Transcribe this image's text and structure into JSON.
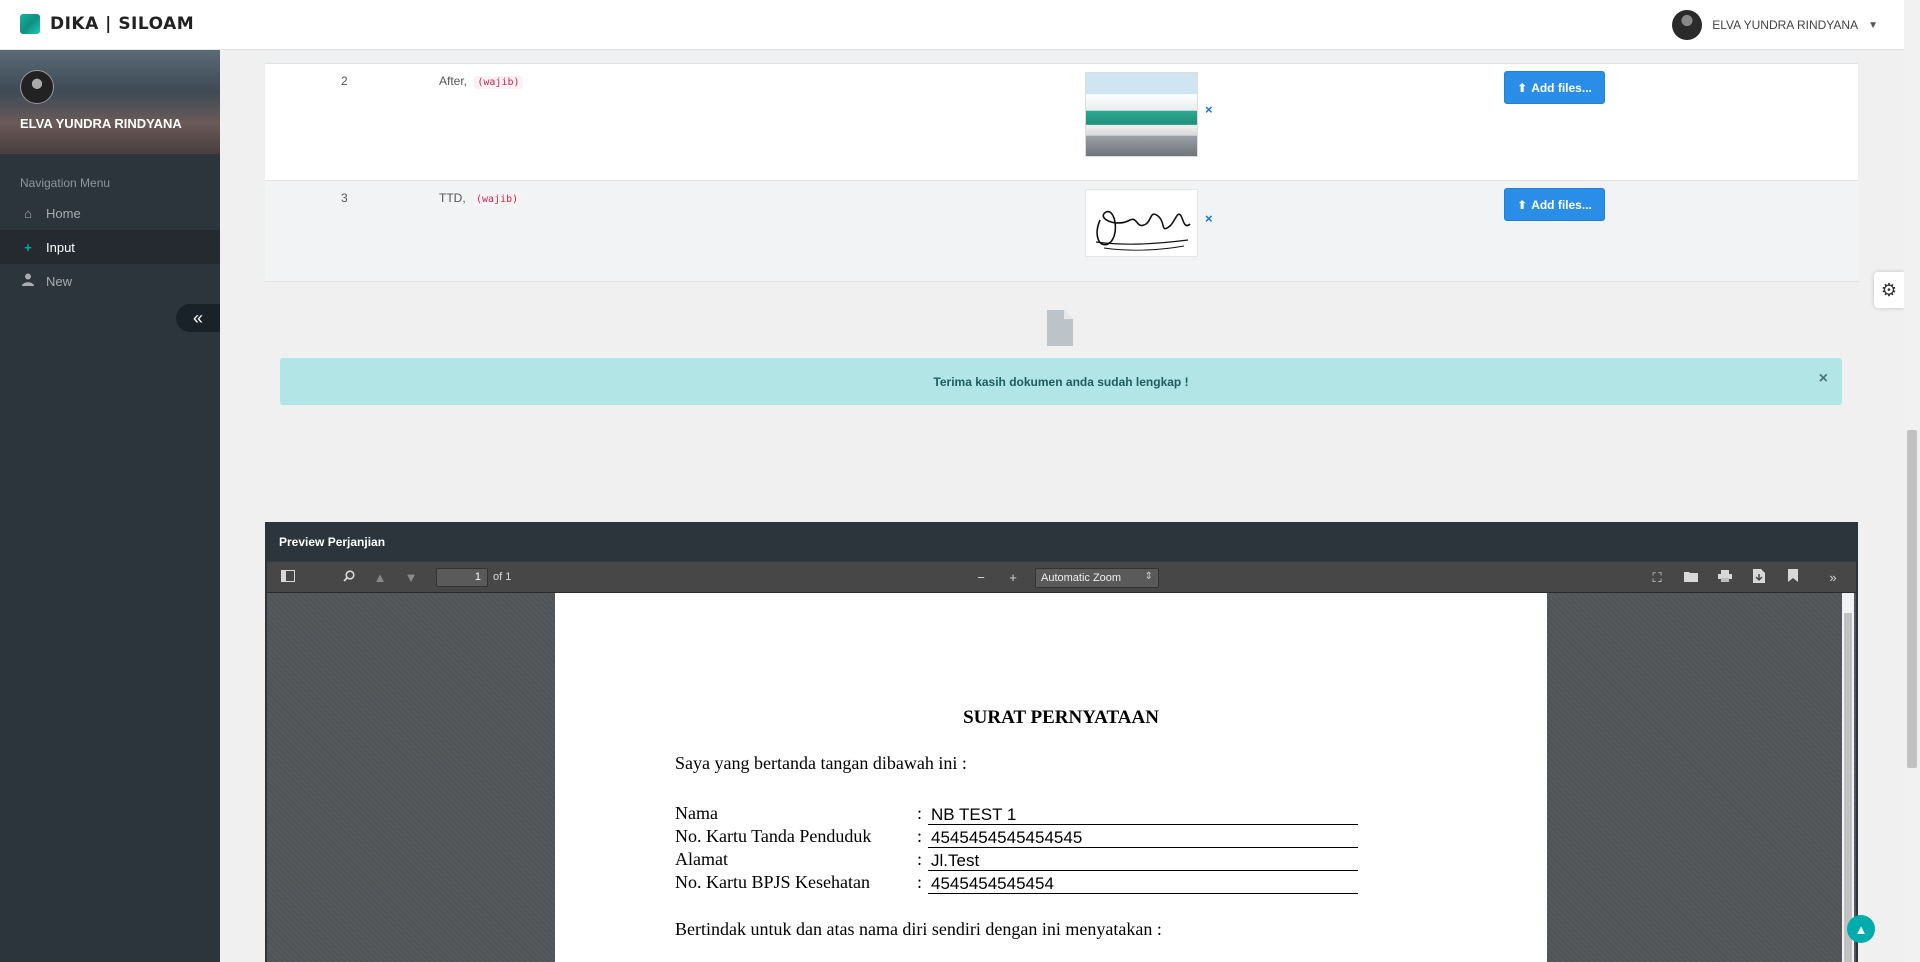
{
  "app": {
    "brand": "DIKA | SILOAM",
    "user_name": "ELVA YUNDRA RINDYANA"
  },
  "sidebar": {
    "profile_name": "ELVA YUNDRA RINDYANA",
    "nav_header": "Navigation Menu",
    "items": [
      {
        "label": "Home",
        "icon": "home-icon",
        "active": false
      },
      {
        "label": "Input",
        "icon": "plus-icon",
        "active": true
      },
      {
        "label": "New",
        "icon": "user-icon",
        "active": false
      }
    ],
    "collapse_glyph": "«"
  },
  "documents": {
    "rows": [
      {
        "no": "2",
        "label": "After,",
        "tag": "(wajib)",
        "thumb": "building-photo",
        "remove": "×",
        "button": "Add files..."
      },
      {
        "no": "3",
        "label": "TTD,",
        "tag": "(wajib)",
        "thumb": "signature",
        "remove": "×",
        "button": "Add files..."
      }
    ]
  },
  "alert": {
    "text": "Terima kasih dokumen anda sudah lengkap !",
    "close": "×"
  },
  "preview": {
    "title": "Preview Perjanjian",
    "toolbar": {
      "page_value": "1",
      "page_of": "of 1",
      "zoom": "Automatic Zoom",
      "zoom_out": "−",
      "zoom_in": "+"
    },
    "document": {
      "title": "SURAT PERNYATAAN",
      "intro": "Saya yang bertanda tangan dibawah ini :",
      "fields": [
        {
          "label": "Nama",
          "value": "NB TEST 1"
        },
        {
          "label": "No. Kartu Tanda Penduduk",
          "value": "4545454545454545"
        },
        {
          "label": "Alamat",
          "value": "Jl.Test"
        },
        {
          "label": "No. Kartu BPJS Kesehatan",
          "value": "4545454545454"
        }
      ],
      "colon": ":",
      "statement": "Bertindak untuk dan atas nama diri sendiri dengan ini menyatakan :"
    }
  },
  "colors": {
    "sidebar": "#2d353c",
    "accent": "#00acac",
    "button": "#2a8ee8",
    "alert_bg": "#b2e5e5"
  }
}
